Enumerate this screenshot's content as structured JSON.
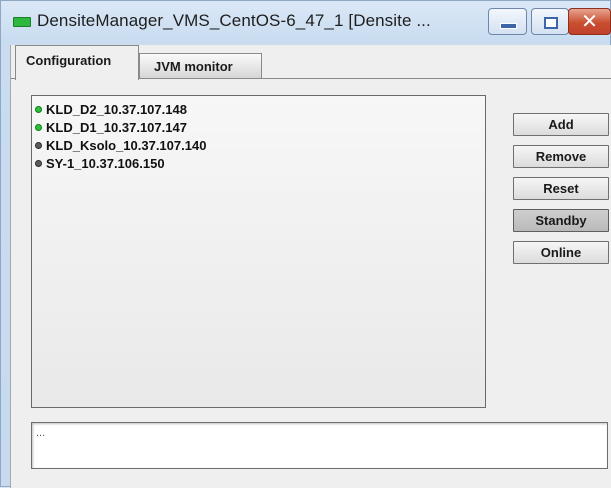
{
  "window": {
    "title": "DensiteManager_VMS_CentOS-6_47_1 [Densite ...",
    "minimize_icon": "minimize-icon",
    "maximize_icon": "maximize-icon",
    "close_glyph": "✕"
  },
  "tabs": [
    {
      "label": "Configuration",
      "selected": true
    },
    {
      "label": "JVM monitor",
      "selected": false
    }
  ],
  "devices": [
    {
      "label": "KLD_D2_10.37.107.148",
      "status": "online"
    },
    {
      "label": "KLD_D1_10.37.107.147",
      "status": "online"
    },
    {
      "label": "KLD_Ksolo_10.37.107.140",
      "status": "offline"
    },
    {
      "label": "SY-1_10.37.106.150",
      "status": "offline"
    }
  ],
  "actions": {
    "add": "Add",
    "remove": "Remove",
    "reset": "Reset",
    "standby": "Standby",
    "online": "Online"
  },
  "status_text": "...",
  "colors": {
    "online": "#29c43a",
    "offline": "#5c5c5c",
    "close_button": "#c94f31"
  }
}
